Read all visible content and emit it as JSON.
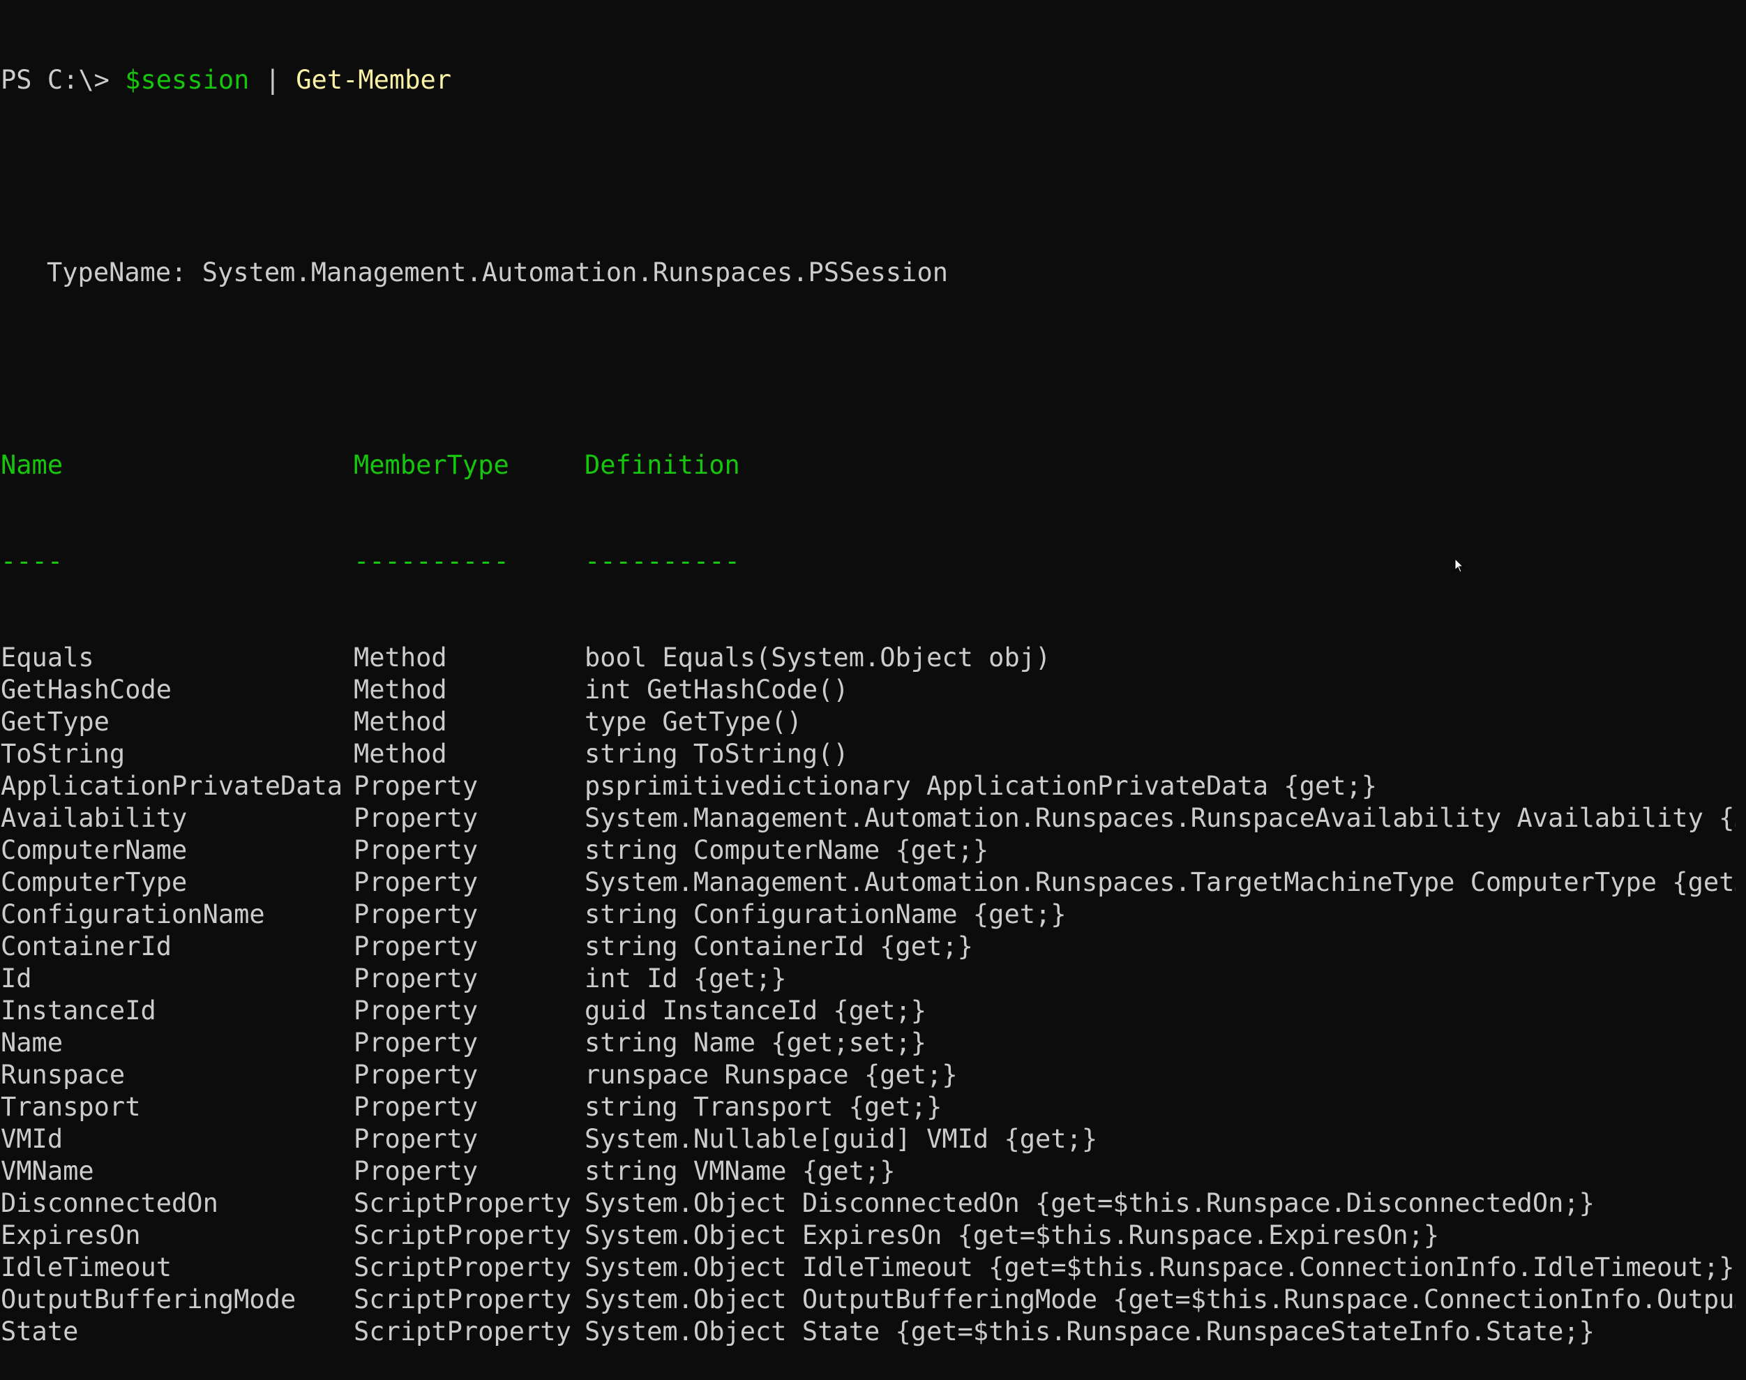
{
  "prompt": {
    "prefix": "PS C:\\> ",
    "variable": "$session",
    "pipe": " | ",
    "cmdlet": "Get-Member"
  },
  "typename": "TypeName: System.Management.Automation.Runspaces.PSSession",
  "table": {
    "headers": [
      "Name",
      "MemberType",
      "Definition"
    ],
    "underlines": [
      "----",
      "----------",
      "----------"
    ],
    "rows": [
      [
        "Equals",
        "Method",
        "bool Equals(System.Object obj)"
      ],
      [
        "GetHashCode",
        "Method",
        "int GetHashCode()"
      ],
      [
        "GetType",
        "Method",
        "type GetType()"
      ],
      [
        "ToString",
        "Method",
        "string ToString()"
      ],
      [
        "ApplicationPrivateData",
        "Property",
        "psprimitivedictionary ApplicationPrivateData {get;}"
      ],
      [
        "Availability",
        "Property",
        "System.Management.Automation.Runspaces.RunspaceAvailability Availability {…"
      ],
      [
        "ComputerName",
        "Property",
        "string ComputerName {get;}"
      ],
      [
        "ComputerType",
        "Property",
        "System.Management.Automation.Runspaces.TargetMachineType ComputerType {get…"
      ],
      [
        "ConfigurationName",
        "Property",
        "string ConfigurationName {get;}"
      ],
      [
        "ContainerId",
        "Property",
        "string ContainerId {get;}"
      ],
      [
        "Id",
        "Property",
        "int Id {get;}"
      ],
      [
        "InstanceId",
        "Property",
        "guid InstanceId {get;}"
      ],
      [
        "Name",
        "Property",
        "string Name {get;set;}"
      ],
      [
        "Runspace",
        "Property",
        "runspace Runspace {get;}"
      ],
      [
        "Transport",
        "Property",
        "string Transport {get;}"
      ],
      [
        "VMId",
        "Property",
        "System.Nullable[guid] VMId {get;}"
      ],
      [
        "VMName",
        "Property",
        "string VMName {get;}"
      ],
      [
        "DisconnectedOn",
        "ScriptProperty",
        "System.Object DisconnectedOn {get=$this.Runspace.DisconnectedOn;}"
      ],
      [
        "ExpiresOn",
        "ScriptProperty",
        "System.Object ExpiresOn {get=$this.Runspace.ExpiresOn;}"
      ],
      [
        "IdleTimeout",
        "ScriptProperty",
        "System.Object IdleTimeout {get=$this.Runspace.ConnectionInfo.IdleTimeout;}"
      ],
      [
        "OutputBufferingMode",
        "ScriptProperty",
        "System.Object OutputBufferingMode {get=$this.Runspace.ConnectionInfo.Outpu…"
      ],
      [
        "State",
        "ScriptProperty",
        "System.Object State {get=$this.Runspace.RunspaceStateInfo.State;}"
      ]
    ]
  },
  "colors": {
    "background": "#0c0c0c",
    "text": "#cccccc",
    "header": "#16c60c",
    "cmdlet": "#f9f1a5"
  },
  "icons": {
    "pointer": "mouse-pointer-icon"
  }
}
